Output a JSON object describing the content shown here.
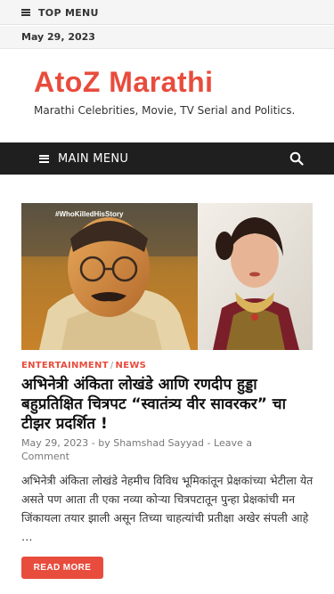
{
  "colors": {
    "accent": "#e84c3d",
    "nav_bg": "#1f1f1f",
    "top_bg": "#f5f5f5"
  },
  "top_bar": {
    "menu_label": "TOP MENU",
    "icon": "hamburger-icon"
  },
  "date_bar": {
    "date": "May 29, 2023"
  },
  "header": {
    "site_title": "AtoZ Marathi",
    "tagline": "Marathi Celebrities, Movie, TV Serial and Politics."
  },
  "main_nav": {
    "menu_label": "MAIN MENU",
    "menu_icon": "hamburger-icon",
    "search_icon": "search-icon"
  },
  "post": {
    "thumbnail_caption": "#WhoKilledHisStory",
    "categories": [
      "ENTERTAINMENT",
      "NEWS"
    ],
    "category_separator": "/",
    "title": "अभिनेत्री अंकिता लोखंडे आणि रणदीप हुड्डा बहुप्रतिक्षित चित्रपट “स्वातंत्र्य वीर सावरकर” चा टीझर प्रदर्शित !",
    "date": "May 29, 2023",
    "meta_separator": "-",
    "by_prefix": "by",
    "author": "Shamshad Sayyad",
    "comment_link": "Leave a Comment",
    "excerpt": "अभिनेत्री अंकिता लोखंडे नेहमीच विविध भूमिकांतून प्रेक्षकांच्या भेटीला येत असते पण आता ती एका नव्या कोऱ्या चित्रपटातून पुन्हा प्रेक्षकांची मन जिंकायला तयार झाली असून तिच्या चाहत्यांची प्रतीक्षा अखेर संपली आहे …",
    "read_more_label": "READ MORE"
  }
}
